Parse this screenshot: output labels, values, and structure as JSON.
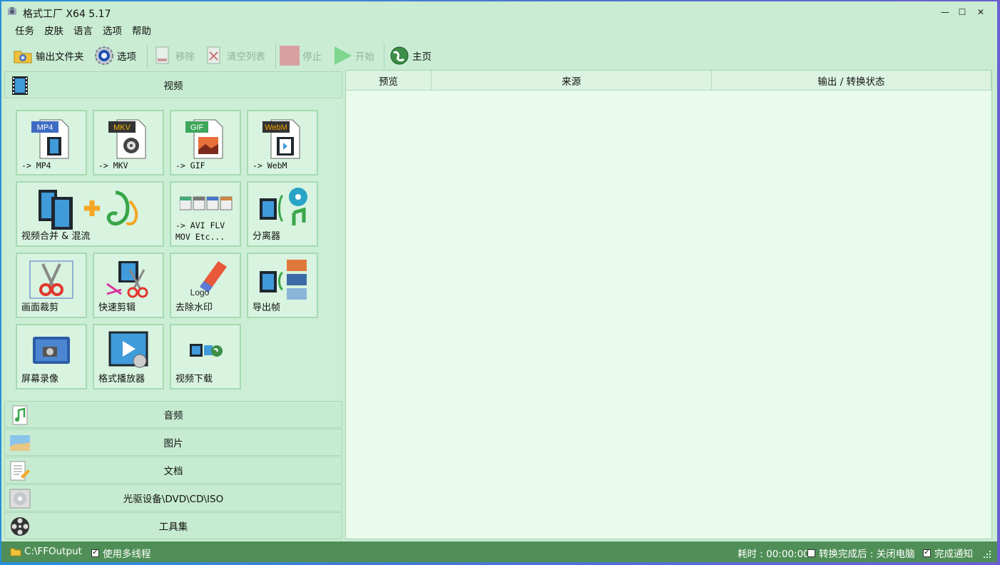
{
  "window": {
    "title": "格式工厂 X64 5.17"
  },
  "menu": [
    "任务",
    "皮肤",
    "语言",
    "选项",
    "帮助"
  ],
  "toolbar": {
    "output_folder": "输出文件夹",
    "options": "选项",
    "remove": "移除",
    "clear_list": "清空列表",
    "stop": "停止",
    "start": "开始",
    "home": "主页"
  },
  "categories": {
    "video": "视频",
    "audio": "音频",
    "picture": "图片",
    "document": "文档",
    "disc": "光驱设备\\DVD\\CD\\ISO",
    "tools": "工具集"
  },
  "video_tiles": {
    "mp4": {
      "label": "-> MP4",
      "badge": "MP4"
    },
    "mkv": {
      "label": "-> MKV",
      "badge": "MKV"
    },
    "gif": {
      "label": "-> GIF",
      "badge": "GIF"
    },
    "webm": {
      "label": "-> WebM",
      "badge": "WebM"
    },
    "merge": {
      "label": "视频合并 & 混流"
    },
    "avi": {
      "label": "-> AVI FLV\nMOV Etc..."
    },
    "splitter": {
      "label": "分离器"
    },
    "crop": {
      "label": "画面裁剪"
    },
    "quickclip": {
      "label": "快速剪辑"
    },
    "watermark": {
      "label": "去除水印",
      "logo_text": "Logo"
    },
    "export_frame": {
      "label": "导出帧"
    },
    "screen_rec": {
      "label": "屏幕录像"
    },
    "player": {
      "label": "格式播放器"
    },
    "download": {
      "label": "视频下载"
    }
  },
  "table": {
    "columns": [
      "预览",
      "来源",
      "输出 / 转换状态"
    ]
  },
  "status": {
    "output_path": "C:\\FFOutput",
    "multithread": "使用多线程",
    "elapsed": "耗时 : 00:00:00",
    "after_done": "转换完成后 : 关闭电脑",
    "notify": "完成通知"
  },
  "colors": {
    "window_bg": "#c9ecd3",
    "status_bar": "#4f8f57",
    "tile_border": "#a5dbb2"
  }
}
